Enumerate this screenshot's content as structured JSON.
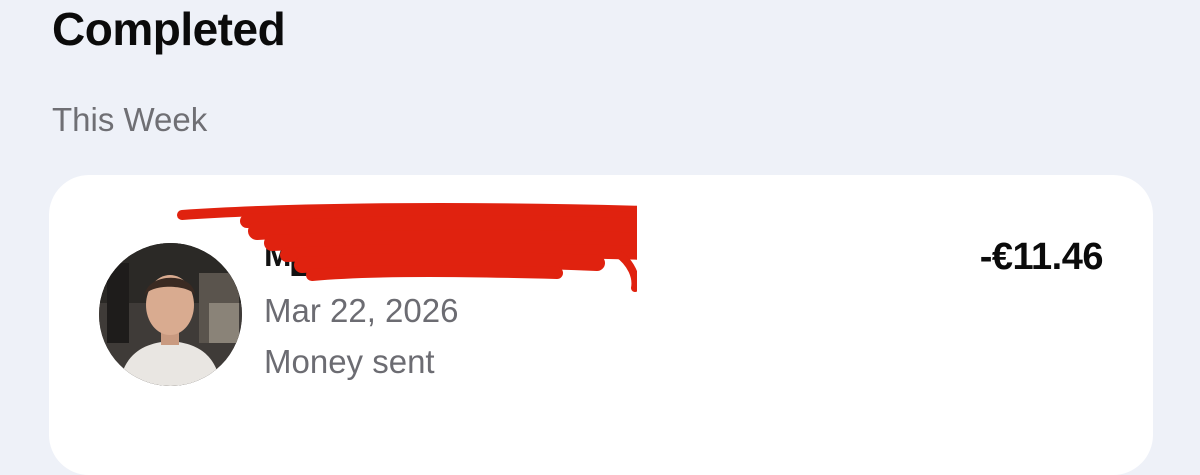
{
  "page": {
    "title": "Completed",
    "group_label": "This Week"
  },
  "transaction": {
    "recipient_name": "M███ ███████",
    "date": "Mar 22, 2026",
    "type": "Money sent",
    "amount": "-€11.46",
    "avatar_icon": "profile-photo",
    "redaction_color": "#e0220f"
  }
}
